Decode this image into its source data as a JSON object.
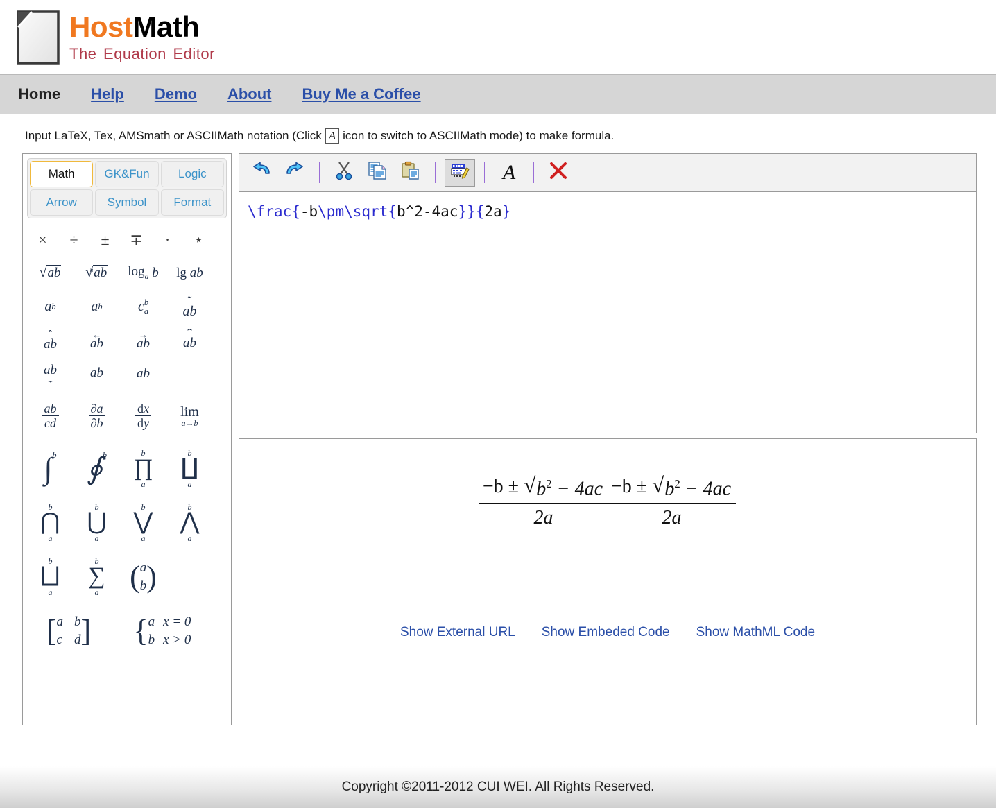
{
  "header": {
    "brand_host": "Host",
    "brand_math": "Math",
    "tagline": "The Equation Editor",
    "logo_icon": "document-page-icon",
    "color_host": "#f07820",
    "color_math": "#000000",
    "color_tagline": "#b03a4a"
  },
  "nav": {
    "items": [
      {
        "label": "Home",
        "is_link": false
      },
      {
        "label": "Help",
        "is_link": true
      },
      {
        "label": "Demo",
        "is_link": true
      },
      {
        "label": "About",
        "is_link": true
      },
      {
        "label": "Buy Me a Coffee",
        "is_link": true
      }
    ],
    "link_color": "#2b4fa8",
    "background": "#d6d6d6"
  },
  "instruction": {
    "part1": "Input LaTeX, Tex, AMSmath or ASCIIMath notation (Click",
    "icon_letter": "A",
    "part2": "icon to switch to ASCIIMath mode) to make formula."
  },
  "palette": {
    "tabs": [
      {
        "label": "Math",
        "active": true
      },
      {
        "label": "GK&Fun",
        "active": false
      },
      {
        "label": "Logic",
        "active": false
      },
      {
        "label": "Arrow",
        "active": false
      },
      {
        "label": "Symbol",
        "active": false
      },
      {
        "label": "Format",
        "active": false
      }
    ],
    "active_tab_border": "#f0b93c",
    "inactive_tab_text": "#3c93c9",
    "operators": [
      "×",
      "÷",
      "±",
      "∓",
      "·",
      "⋆"
    ],
    "row_functions": [
      "sqrt-ab",
      "nth-root-ab",
      "log-base-a-b",
      "lg-ab"
    ],
    "row_scripts": [
      "a-superscript-b",
      "a-subscript-b",
      "c-sub-a-sup-b",
      "widetilde-ab"
    ],
    "row_accents": [
      "widehat-ab",
      "overleftarrow-ab",
      "overrightarrow-ab",
      "overbrace-ab"
    ],
    "row_unders": [
      "underbrace-ab",
      "underline-ab",
      "overline-ab"
    ],
    "row_fractions": [
      "frac-ab-cd",
      "partial-a-partial-b",
      "dx-dy",
      "lim-a-to-b"
    ],
    "row_integrals": [
      "integral-a-b",
      "contour-integral-a-b",
      "product-a-b",
      "coproduct-a-b"
    ],
    "row_bigops": [
      "bigcap-a-b",
      "bigcup-a-b",
      "bigvee-a-b",
      "bigwedge-a-b"
    ],
    "row_bigops2": [
      "bigsqcup-a-b",
      "sum-a-b",
      "binomial-a-b"
    ],
    "row_matrix": [
      "matrix-2x2",
      "cases-2"
    ]
  },
  "toolbar": {
    "buttons": [
      {
        "name": "undo-button",
        "icon": "undo-arrow-icon",
        "pressed": false
      },
      {
        "name": "redo-button",
        "icon": "redo-arrow-icon",
        "pressed": false
      },
      {
        "name": "cut-button",
        "icon": "scissors-icon",
        "pressed": false
      },
      {
        "name": "copy-button",
        "icon": "copy-documents-icon",
        "pressed": false
      },
      {
        "name": "paste-button",
        "icon": "clipboard-paste-icon",
        "pressed": false
      },
      {
        "name": "latex-mode-button",
        "icon": "latex-keyboard-icon",
        "pressed": true
      },
      {
        "name": "asciimath-mode-button",
        "icon": "letter-A-icon",
        "pressed": false
      },
      {
        "name": "clear-button",
        "icon": "red-x-icon",
        "pressed": false
      }
    ]
  },
  "editor": {
    "latex_value": "\\frac{-b\\pm\\sqrt{b^2-4ac}}{2a}",
    "tokens": [
      {
        "t": "\\frac{",
        "cmd": true
      },
      {
        "t": "-b",
        "cmd": false
      },
      {
        "t": "\\pm\\sqrt{",
        "cmd": true
      },
      {
        "t": "b^2-4ac",
        "cmd": false
      },
      {
        "t": "}}{",
        "cmd": true
      },
      {
        "t": "2a",
        "cmd": false
      },
      {
        "t": "}",
        "cmd": true
      }
    ],
    "cmd_color": "#2b2bcf",
    "plain_color": "#111111"
  },
  "output": {
    "formula_count": 2,
    "formula": {
      "numer_lead": "−b ±",
      "radical": "√",
      "radicand_base": "b",
      "radicand_exp": "2",
      "radicand_rest": " − 4ac",
      "denom": "2a"
    },
    "links": [
      "Show External URL",
      "Show Embeded Code",
      "Show MathML Code"
    ],
    "link_color": "#2b4fa8"
  },
  "footer": {
    "copyright": "Copyright ©2011-2012 CUI WEI. All Rights Reserved."
  }
}
